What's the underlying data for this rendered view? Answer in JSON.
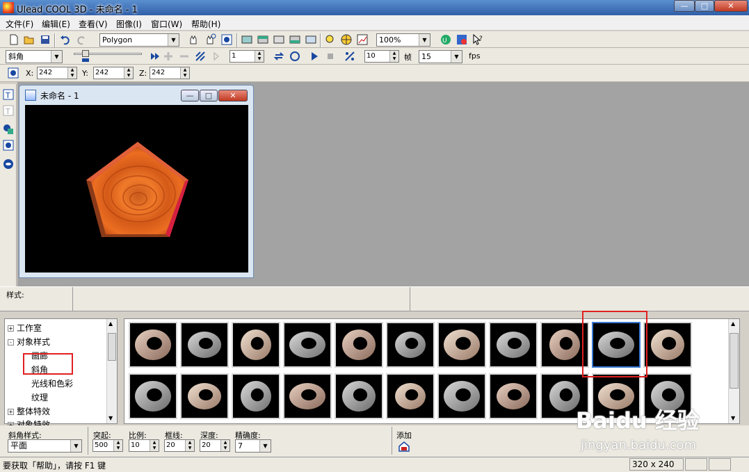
{
  "window": {
    "title": "Ulead COOL 3D - 未命名 - 1"
  },
  "menu": [
    "文件(F)",
    "编辑(E)",
    "查看(V)",
    "图像(I)",
    "窗口(W)",
    "帮助(H)"
  ],
  "toolbar1": {
    "object_combo": "Polygon",
    "zoom_combo": "100%"
  },
  "toolbar2": {
    "effect_combo": "斜角",
    "frame_value": "1",
    "frames_value": "10",
    "frames_label": "帧",
    "fps_value": "15",
    "fps_label": "fps"
  },
  "toolbar3": {
    "x_label": "X:",
    "x_value": "242",
    "y_label": "Y:",
    "y_value": "242",
    "z_label": "Z:",
    "z_value": "242"
  },
  "document": {
    "title": "未命名 - 1"
  },
  "style_panel": {
    "label": "样式:"
  },
  "tree": {
    "items": [
      {
        "label": "工作室",
        "expander": "+"
      },
      {
        "label": "对象样式",
        "expander": "-"
      },
      {
        "label": "画廊",
        "expander": ""
      },
      {
        "label": "斜角",
        "expander": ""
      },
      {
        "label": "光线和色彩",
        "expander": ""
      },
      {
        "label": "纹理",
        "expander": ""
      },
      {
        "label": "整体特效",
        "expander": "+"
      },
      {
        "label": "对象特效",
        "expander": "+"
      }
    ]
  },
  "bevel": {
    "style_label": "斜角样式:",
    "style_value": "平面",
    "protrude_label": "突起:",
    "protrude_value": "500",
    "scale_label": "比例:",
    "scale_value": "10",
    "border_label": "框线:",
    "border_value": "20",
    "depth_label": "深度:",
    "depth_value": "20",
    "precision_label": "精确度:",
    "precision_value": "7",
    "add_label": "添加"
  },
  "status": {
    "hint": "要获取「帮助」，请按 F1 键",
    "size": "320 x 240"
  },
  "watermark": {
    "brand": "Baidu 经验",
    "url": "jingyan.baidu.com"
  },
  "colors": {
    "highlight": "#e02020",
    "workspace": "#a3a3a3",
    "shape_fill": "#d95a1a"
  }
}
